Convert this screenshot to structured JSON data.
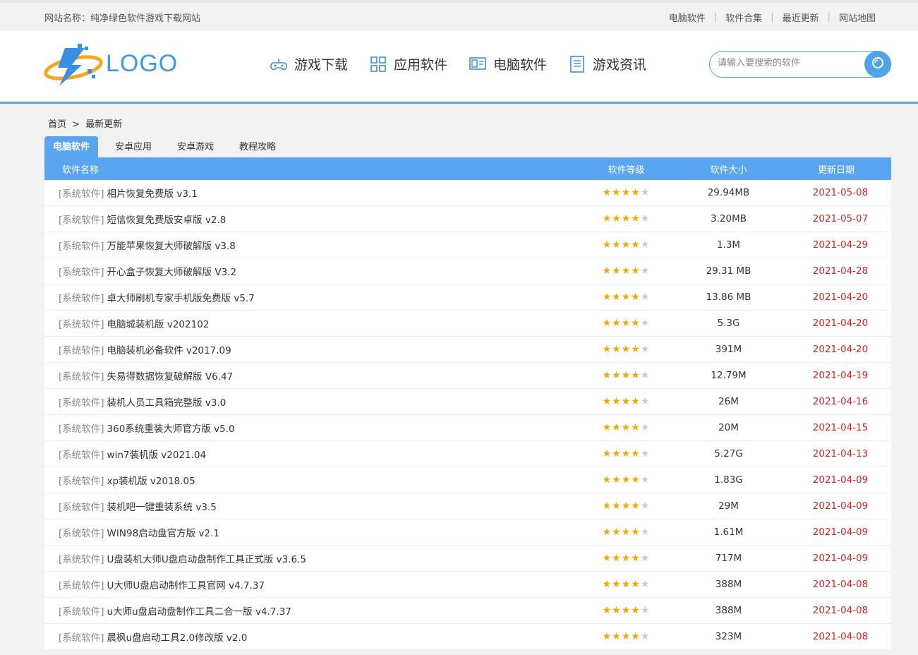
{
  "topbar": {
    "site_name": "网站名称：纯净绿色软件游戏下载网站",
    "links": [
      "电脑软件",
      "软件合集",
      "最近更新",
      "网站地图"
    ]
  },
  "header": {
    "logo_text": "LOGO",
    "nav": [
      {
        "label": "游戏下载",
        "icon": "gamepad-icon"
      },
      {
        "label": "应用软件",
        "icon": "apps-grid-icon"
      },
      {
        "label": "电脑软件",
        "icon": "computer-icon"
      },
      {
        "label": "游戏资讯",
        "icon": "news-icon"
      }
    ],
    "search_placeholder": "请输入要搜索的软件"
  },
  "breadcrumb": {
    "home": "首页",
    "sep": ">",
    "current": "最新更新"
  },
  "tabs": [
    "电脑软件",
    "安卓应用",
    "安卓游戏",
    "教程攻略"
  ],
  "table": {
    "headers": [
      "软件名称",
      "软件等级",
      "软件大小",
      "更新日期"
    ],
    "rating_stars": 4,
    "rating_max": 5,
    "rows": [
      {
        "cat": "[系统软件]",
        "name": "相片恢复免费版 v3.1",
        "size": "29.94MB",
        "date": "2021-05-08"
      },
      {
        "cat": "[系统软件]",
        "name": "短信恢复免费版安卓版 v2.8",
        "size": "3.20MB",
        "date": "2021-05-07"
      },
      {
        "cat": "[系统软件]",
        "name": "万能苹果恢复大师破解版 v3.8",
        "size": "1.3M",
        "date": "2021-04-29"
      },
      {
        "cat": "[系统软件]",
        "name": "开心盒子恢复大师破解版 V3.2",
        "size": "29.31 MB",
        "date": "2021-04-28"
      },
      {
        "cat": "[系统软件]",
        "name": "卓大师刷机专家手机版免费版 v5.7",
        "size": "13.86 MB",
        "date": "2021-04-20"
      },
      {
        "cat": "[系统软件]",
        "name": "电脑城装机版 v202102",
        "size": "5.3G",
        "date": "2021-04-20"
      },
      {
        "cat": "[系统软件]",
        "name": "电脑装机必备软件 v2017.09",
        "size": "391M",
        "date": "2021-04-20"
      },
      {
        "cat": "[系统软件]",
        "name": "失易得数据恢复破解版 V6.47",
        "size": "12.79M",
        "date": "2021-04-19"
      },
      {
        "cat": "[系统软件]",
        "name": "装机人员工具箱完整版 v3.0",
        "size": "26M",
        "date": "2021-04-16"
      },
      {
        "cat": "[系统软件]",
        "name": "360系统重装大师官方版 v5.0",
        "size": "20M",
        "date": "2021-04-15"
      },
      {
        "cat": "[系统软件]",
        "name": "win7装机版 v2021.04",
        "size": "5.27G",
        "date": "2021-04-13"
      },
      {
        "cat": "[系统软件]",
        "name": "xp装机版 v2018.05",
        "size": "1.83G",
        "date": "2021-04-09"
      },
      {
        "cat": "[系统软件]",
        "name": "装机吧一键重装系统 v3.5",
        "size": "29M",
        "date": "2021-04-09"
      },
      {
        "cat": "[系统软件]",
        "name": "WIN98启动盘官方版 v2.1",
        "size": "1.61M",
        "date": "2021-04-09"
      },
      {
        "cat": "[系统软件]",
        "name": "U盘装机大师U盘启动盘制作工具正式版 v3.6.5",
        "size": "717M",
        "date": "2021-04-09"
      },
      {
        "cat": "[系统软件]",
        "name": "U大师U盘启动制作工具官网 v4.7.37",
        "size": "388M",
        "date": "2021-04-08"
      },
      {
        "cat": "[系统软件]",
        "name": "u大师u盘启动盘制作工具二合一版 v4.7.37",
        "size": "388M",
        "date": "2021-04-08"
      },
      {
        "cat": "[系统软件]",
        "name": "晨枫u盘启动工具2.0修改版 v2.0",
        "size": "323M",
        "date": "2021-04-08"
      }
    ]
  }
}
